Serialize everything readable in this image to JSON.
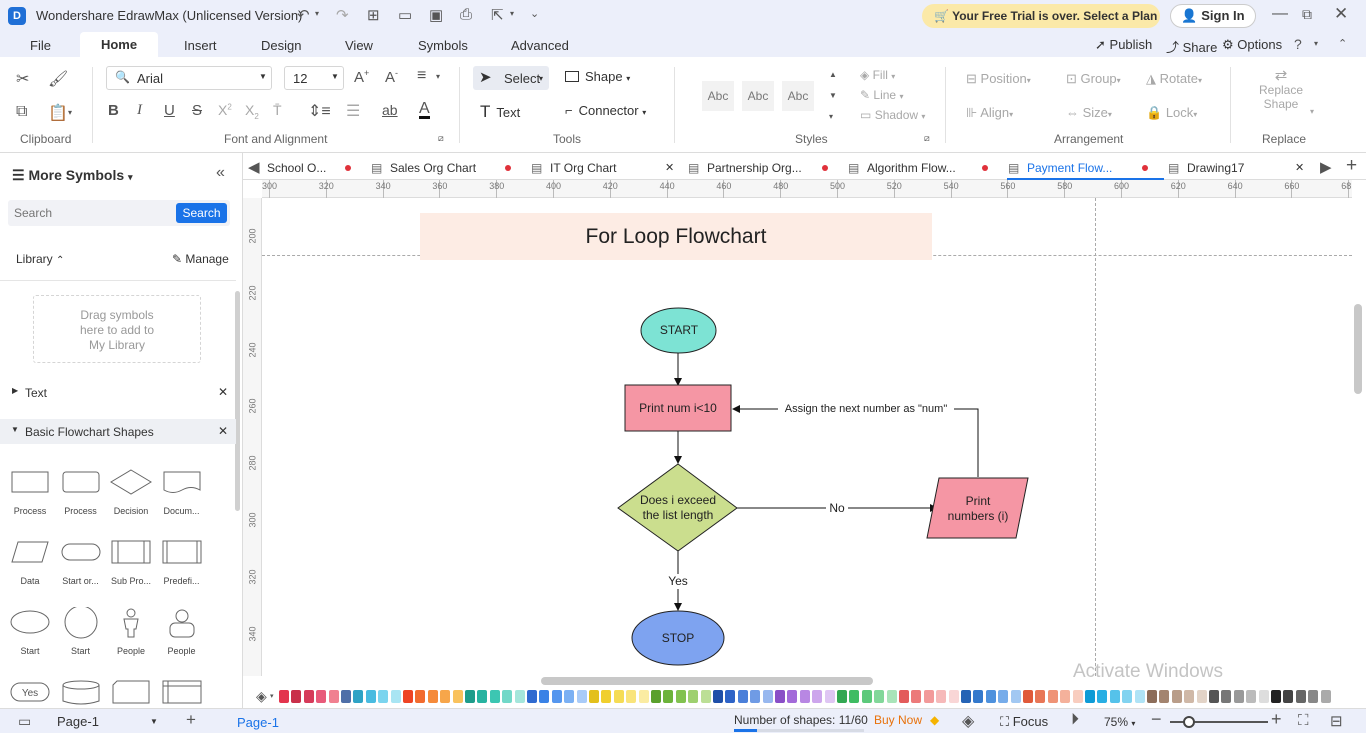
{
  "titlebar": {
    "app_title": "Wondershare EdrawMax (Unlicensed Version)",
    "trial_banner": "Your Free Trial is over. Select a Plan",
    "sign_in": "Sign In"
  },
  "menu": {
    "items": [
      "File",
      "Home",
      "Insert",
      "Design",
      "View",
      "Symbols",
      "Advanced"
    ],
    "active": "Home",
    "publish": "Publish",
    "share": "Share",
    "options": "Options"
  },
  "ribbon": {
    "font_name": "Arial",
    "font_size": "12",
    "select_label": "Select",
    "shape_label": "Shape",
    "text_label": "Text",
    "connector_label": "Connector",
    "style_samples": [
      "Abc",
      "Abc",
      "Abc"
    ],
    "fill_label": "Fill",
    "line_label": "Line",
    "shadow_label": "Shadow",
    "position_label": "Position",
    "group_label": "Group",
    "rotate_label": "Rotate",
    "align_label": "Align",
    "size_label": "Size",
    "lock_label": "Lock",
    "replace_shape_label1": "Replace",
    "replace_shape_label2": "Shape",
    "groups": {
      "clipboard": "Clipboard",
      "font": "Font and Alignment",
      "tools": "Tools",
      "styles": "Styles",
      "arrangement": "Arrangement",
      "replace": "Replace"
    }
  },
  "left_panel": {
    "title": "More Symbols",
    "search_placeholder": "Search",
    "search_button": "Search",
    "library_label": "Library",
    "manage_label": "Manage",
    "drop_hint_1": "Drag symbols",
    "drop_hint_2": "here to add to",
    "drop_hint_3": "My Library",
    "section_text": "Text",
    "section_basic": "Basic Flowchart Shapes",
    "shapes": [
      {
        "label": "Process",
        "icon": "process-shape-icon"
      },
      {
        "label": "Process",
        "icon": "process-rounded-shape-icon"
      },
      {
        "label": "Decision",
        "icon": "decision-shape-icon"
      },
      {
        "label": "Docum...",
        "icon": "document-shape-icon"
      },
      {
        "label": "Data",
        "icon": "data-shape-icon"
      },
      {
        "label": "Start or...",
        "icon": "terminator-shape-icon"
      },
      {
        "label": "Sub Pro...",
        "icon": "subprocess-shape-icon"
      },
      {
        "label": "Predefi...",
        "icon": "predefined-shape-icon"
      },
      {
        "label": "Start",
        "icon": "start-ellipse-shape-icon"
      },
      {
        "label": "Start",
        "icon": "start-circle-shape-icon"
      },
      {
        "label": "People",
        "icon": "person-shape-icon"
      },
      {
        "label": "People",
        "icon": "people-shape-icon"
      },
      {
        "label": "Yes",
        "icon": "yes-shape-icon"
      },
      {
        "label": "",
        "icon": "database-shape-icon"
      },
      {
        "label": "",
        "icon": "card-shape-icon"
      },
      {
        "label": "",
        "icon": "internal-storage-shape-icon"
      }
    ]
  },
  "tabs": [
    {
      "label": "School O...",
      "dot": true
    },
    {
      "label": "Sales Org Chart",
      "dot": true
    },
    {
      "label": "IT Org Chart",
      "dot": false
    },
    {
      "label": "Partnership Org...",
      "dot": true
    },
    {
      "label": "Algorithm Flow...",
      "dot": true
    },
    {
      "label": "Payment Flow...",
      "dot": true,
      "active": true
    },
    {
      "label": "Drawing17",
      "dot": false
    }
  ],
  "rulers": {
    "h_ticks": [
      "300",
      "320",
      "340",
      "360",
      "380",
      "400",
      "420",
      "440",
      "460",
      "480",
      "500",
      "520",
      "540",
      "560",
      "580",
      "600",
      "620",
      "640",
      "660",
      "68"
    ],
    "v_ticks": [
      "200",
      "220",
      "240",
      "260",
      "280",
      "300",
      "320",
      "340"
    ]
  },
  "diagram": {
    "title": "For Loop Flowchart",
    "start": "START",
    "print_num": "Print num i<10",
    "decision_line1": "Does i exceed",
    "decision_line2": "the list length",
    "print_numbers_line1": "Print",
    "print_numbers_line2": "numbers (i)",
    "assign_label": "Assign the next number as \"num\"",
    "no_label": "No",
    "yes_label": "Yes",
    "stop": "STOP"
  },
  "colors": {
    "accent": "#1a73e8",
    "terminator_start": "#7de3d4",
    "process_fill": "#f596a4",
    "decision_fill": "#cbde8e",
    "stop_fill": "#7ea3f0",
    "title_bg": "#fdece4",
    "palette": [
      "#e3344d",
      "#c9304a",
      "#d63b5a",
      "#e85a7a",
      "#f08090",
      "#4f6fa8",
      "#2fa3c5",
      "#49bbe0",
      "#7bd4ee",
      "#a9e5f3",
      "#ee4424",
      "#f26b2e",
      "#f58a3a",
      "#f7a64a",
      "#f9c25d",
      "#1e9c8a",
      "#27b3a0",
      "#3cc6b2",
      "#72d8c8",
      "#a5e6db",
      "#2f6ad0",
      "#3a82e6",
      "#5596ee",
      "#7bb0f3",
      "#a9cbf8",
      "#e3c01c",
      "#f0cf2e",
      "#f5dc55",
      "#f9e47b",
      "#fbeca2",
      "#5aa02c",
      "#6cb33a",
      "#82c24f",
      "#9ed06f",
      "#bcdf96",
      "#1f4fa8",
      "#2d63c7",
      "#4a7fd9",
      "#6f9be5",
      "#98b8ef",
      "#8a4fc7",
      "#a36ad9",
      "#b887e3",
      "#cda6ec",
      "#dfc6f3",
      "#33a852",
      "#3fbc62",
      "#5cc97b",
      "#82d79a",
      "#a9e4b9",
      "#e35b5b",
      "#ec7a7a",
      "#f29a9a",
      "#f6b9b9",
      "#f9d6d6",
      "#2563b5",
      "#3479cc",
      "#4d91dd",
      "#76acea",
      "#a2c8f2",
      "#e05a3a",
      "#e87656",
      "#ef9376",
      "#f4b19b",
      "#f8cdbf",
      "#0e9bd6",
      "#28aee3",
      "#55c2ea",
      "#82d3f0",
      "#afe3f6",
      "#8c6d5a",
      "#a3846f",
      "#b99d89",
      "#cfb8a7",
      "#e2d3c7",
      "#555555",
      "#777777",
      "#999999",
      "#bbbbbb",
      "#dddddd",
      "#222222",
      "#444444",
      "#666666",
      "#888888",
      "#aaaaaa"
    ]
  },
  "statusbar": {
    "page_select": "Page-1",
    "page_tab": "Page-1",
    "shape_count": "Number of shapes: 11/60",
    "buy_now": "Buy Now",
    "focus": "Focus",
    "zoom": "75%"
  },
  "watermark": "Activate Windows"
}
